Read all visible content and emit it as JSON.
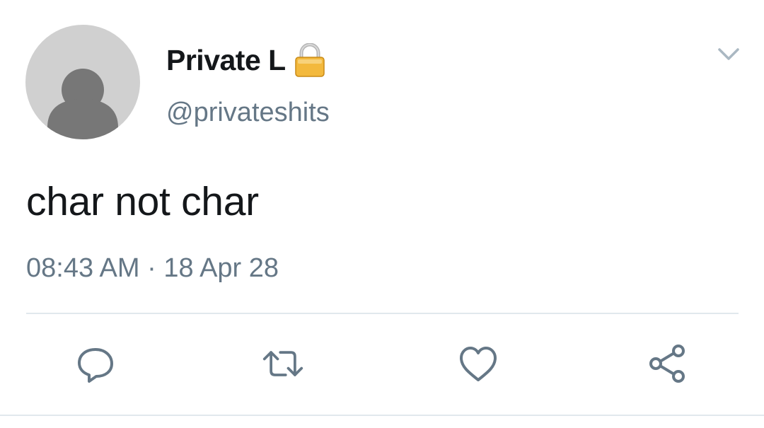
{
  "tweet": {
    "author": {
      "display_name": "Private L",
      "handle": "@privateshits",
      "lock_icon": "lock-icon",
      "avatar_icon": "default-avatar-icon"
    },
    "menu_icon": "chevron-down-icon",
    "text": "char not char",
    "time": "08:43 AM",
    "separator": " · ",
    "date": "18 Apr 28",
    "actions": [
      {
        "name": "reply",
        "icon": "reply-icon"
      },
      {
        "name": "retweet",
        "icon": "retweet-icon"
      },
      {
        "name": "like",
        "icon": "heart-icon"
      },
      {
        "name": "share",
        "icon": "share-icon"
      }
    ]
  },
  "colors": {
    "primary_text": "#14171a",
    "secondary_text": "#657786",
    "icon": "#657786",
    "divider": "#e1e8ed",
    "avatar_bg": "#d0d0d0",
    "avatar_fg": "#777777"
  }
}
